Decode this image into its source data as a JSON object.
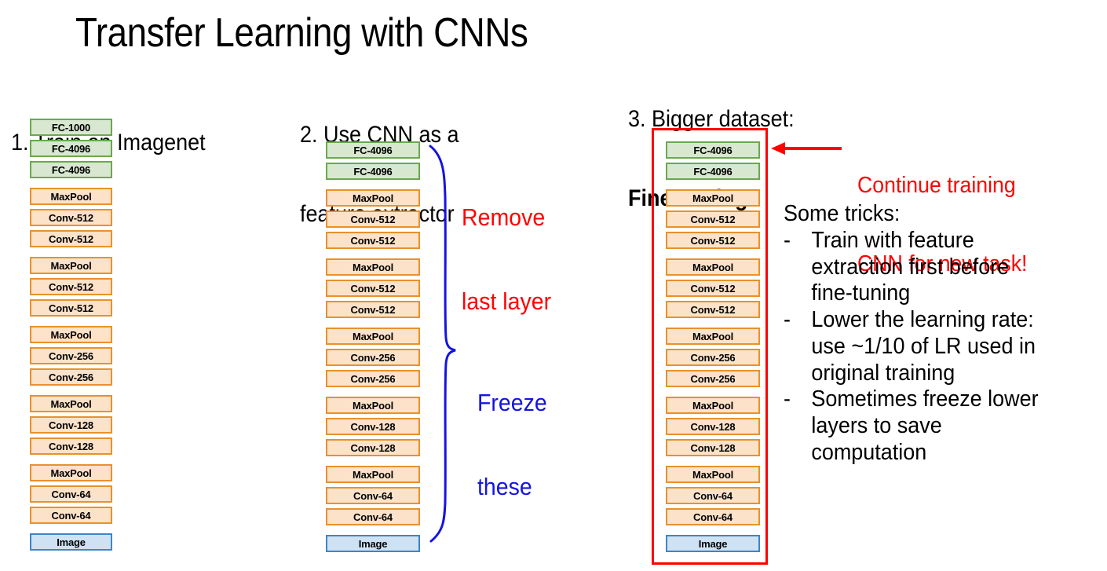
{
  "title": "Transfer Learning with CNNs",
  "columns": {
    "one": {
      "header": "1. Train on Imagenet",
      "layers": [
        {
          "label": "FC-1000",
          "kind": "fc"
        },
        {
          "label": "FC-4096",
          "kind": "fc"
        },
        {
          "label": "FC-4096",
          "kind": "fc",
          "group_end": true
        },
        {
          "label": "MaxPool",
          "kind": "conv"
        },
        {
          "label": "Conv-512",
          "kind": "conv"
        },
        {
          "label": "Conv-512",
          "kind": "conv",
          "group_end": true
        },
        {
          "label": "MaxPool",
          "kind": "conv"
        },
        {
          "label": "Conv-512",
          "kind": "conv"
        },
        {
          "label": "Conv-512",
          "kind": "conv",
          "group_end": true
        },
        {
          "label": "MaxPool",
          "kind": "conv"
        },
        {
          "label": "Conv-256",
          "kind": "conv"
        },
        {
          "label": "Conv-256",
          "kind": "conv",
          "group_end": true
        },
        {
          "label": "MaxPool",
          "kind": "conv"
        },
        {
          "label": "Conv-128",
          "kind": "conv"
        },
        {
          "label": "Conv-128",
          "kind": "conv",
          "group_end": true
        },
        {
          "label": "MaxPool",
          "kind": "conv"
        },
        {
          "label": "Conv-64",
          "kind": "conv"
        },
        {
          "label": "Conv-64",
          "kind": "conv",
          "group_end": true
        },
        {
          "label": "Image",
          "kind": "image",
          "last": true
        }
      ]
    },
    "two": {
      "header_line_1": "2. Use CNN as a",
      "header_line_2": "feature extractor",
      "layers": [
        {
          "label": "FC-4096",
          "kind": "fc"
        },
        {
          "label": "FC-4096",
          "kind": "fc",
          "group_end": true
        },
        {
          "label": "MaxPool",
          "kind": "conv"
        },
        {
          "label": "Conv-512",
          "kind": "conv"
        },
        {
          "label": "Conv-512",
          "kind": "conv",
          "group_end": true
        },
        {
          "label": "MaxPool",
          "kind": "conv"
        },
        {
          "label": "Conv-512",
          "kind": "conv"
        },
        {
          "label": "Conv-512",
          "kind": "conv",
          "group_end": true
        },
        {
          "label": "MaxPool",
          "kind": "conv"
        },
        {
          "label": "Conv-256",
          "kind": "conv"
        },
        {
          "label": "Conv-256",
          "kind": "conv",
          "group_end": true
        },
        {
          "label": "MaxPool",
          "kind": "conv"
        },
        {
          "label": "Conv-128",
          "kind": "conv"
        },
        {
          "label": "Conv-128",
          "kind": "conv",
          "group_end": true
        },
        {
          "label": "MaxPool",
          "kind": "conv"
        },
        {
          "label": "Conv-64",
          "kind": "conv"
        },
        {
          "label": "Conv-64",
          "kind": "conv",
          "group_end": true
        },
        {
          "label": "Image",
          "kind": "image",
          "last": true
        }
      ]
    },
    "three": {
      "header_line_1": "3. Bigger dataset:",
      "header_line_2": "Fine-Tuning",
      "layers": [
        {
          "label": "FC-4096",
          "kind": "fc"
        },
        {
          "label": "FC-4096",
          "kind": "fc",
          "group_end": true
        },
        {
          "label": "MaxPool",
          "kind": "conv"
        },
        {
          "label": "Conv-512",
          "kind": "conv"
        },
        {
          "label": "Conv-512",
          "kind": "conv",
          "group_end": true
        },
        {
          "label": "MaxPool",
          "kind": "conv"
        },
        {
          "label": "Conv-512",
          "kind": "conv"
        },
        {
          "label": "Conv-512",
          "kind": "conv",
          "group_end": true
        },
        {
          "label": "MaxPool",
          "kind": "conv"
        },
        {
          "label": "Conv-256",
          "kind": "conv"
        },
        {
          "label": "Conv-256",
          "kind": "conv",
          "group_end": true
        },
        {
          "label": "MaxPool",
          "kind": "conv"
        },
        {
          "label": "Conv-128",
          "kind": "conv"
        },
        {
          "label": "Conv-128",
          "kind": "conv",
          "group_end": true
        },
        {
          "label": "MaxPool",
          "kind": "conv"
        },
        {
          "label": "Conv-64",
          "kind": "conv"
        },
        {
          "label": "Conv-64",
          "kind": "conv",
          "group_end": true
        },
        {
          "label": "Image",
          "kind": "image",
          "last": true
        }
      ]
    }
  },
  "annotations": {
    "remove_line_1": "Remove",
    "remove_line_2": "last layer",
    "freeze_line_1": "Freeze",
    "freeze_line_2": "these",
    "continue_line_1": "Continue training",
    "continue_line_2": "CNN for new task!"
  },
  "tricks": {
    "title": "Some tricks:",
    "bullet_marker": "-",
    "items": [
      "Train with feature\nextraction first before\nfine-tuning",
      "Lower the learning rate:\nuse ~1/10 of LR used in\noriginal training",
      "Sometimes freeze lower\nlayers to save\ncomputation"
    ]
  },
  "colors": {
    "fc_fill": "#d8e8d0",
    "fc_border": "#6aa84f",
    "conv_fill": "#fce2c8",
    "conv_border": "#e8912d",
    "image_fill": "#cfe2f3",
    "image_border": "#3d85c8",
    "highlight_red": "#ff0000",
    "brace_blue": "#1414e0"
  }
}
